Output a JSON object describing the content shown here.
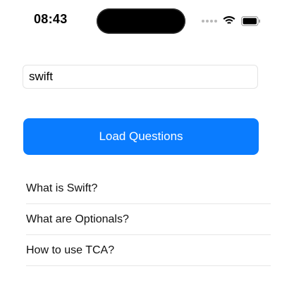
{
  "status_bar": {
    "time": "08:43",
    "icons": [
      "signal-dots-icon",
      "wifi-icon",
      "battery-icon"
    ]
  },
  "search": {
    "value": "swift"
  },
  "load_button": {
    "label": "Load Questions"
  },
  "questions": [
    {
      "title": "What is Swift?"
    },
    {
      "title": "What are Optionals?"
    },
    {
      "title": "How to use TCA?"
    }
  ],
  "colors": {
    "accent": "#0A7CFF",
    "separator": "#E6E6E6",
    "field_border": "#E4E4E4"
  }
}
